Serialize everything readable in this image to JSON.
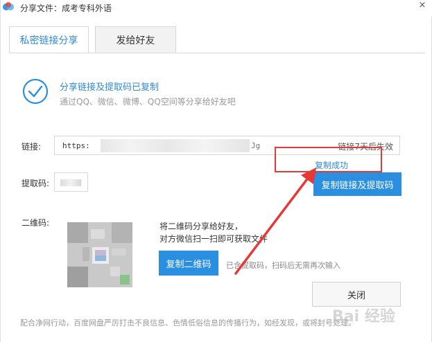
{
  "window": {
    "title": "分享文件：成考专科外语",
    "close_glyph": "×"
  },
  "tabs": [
    {
      "label": "私密链接分享",
      "active": true
    },
    {
      "label": "发给好友",
      "active": false
    }
  ],
  "status": {
    "title": "分享链接及提取码已复制",
    "subtitle": "通过QQ、微信、微博、QQ空间等分享给好友吧"
  },
  "link": {
    "label": "链接:",
    "value_prefix": "https:",
    "value_suffix": "Jg",
    "expire_text": "链接7天后失效"
  },
  "copy_feedback": "复制成功",
  "code": {
    "label": "提取码:"
  },
  "buttons": {
    "copy_link_and_code": "复制链接及提取码",
    "copy_qr": "复制二维码",
    "close": "关闭"
  },
  "qr": {
    "label": "二维码:",
    "share_line1": "将二维码分享给好友，",
    "share_line2": "对方微信扫一扫即可获取文件",
    "note": "已含提取码，扫码后无需再次输入"
  },
  "footer": "配合净网行动，百度网盘严厉打击不良信息、色情低俗信息的传播行为，如经发现，或将封号处理。",
  "watermark": "Bai 经验",
  "colors": {
    "accent": "#2a8fe0",
    "highlight": "#e53935"
  }
}
